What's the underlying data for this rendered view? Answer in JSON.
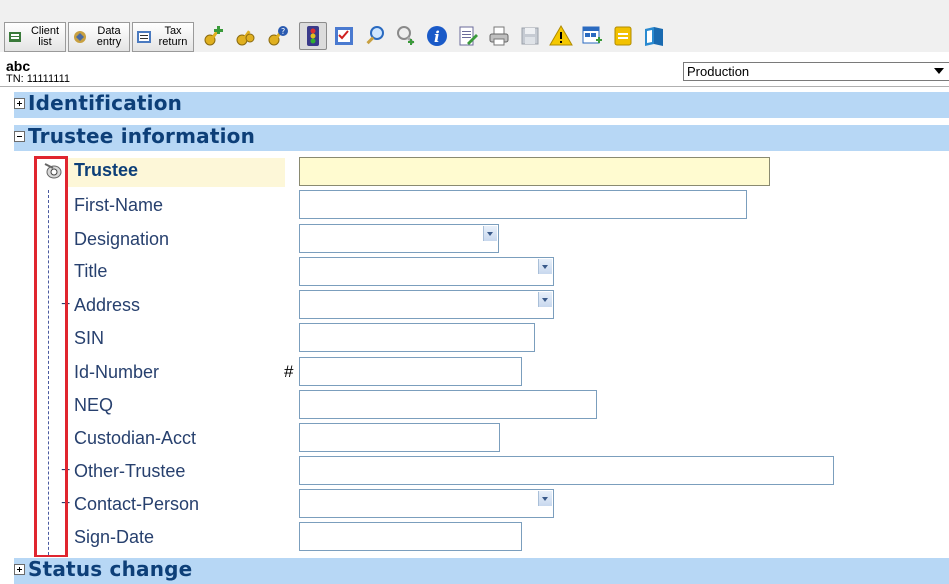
{
  "toolbar": {
    "nav": [
      {
        "label": "Client\nlist"
      },
      {
        "label": "Data\nentry"
      },
      {
        "label": "Tax\nreturn"
      }
    ],
    "icons": [
      "keys-add-icon",
      "keys-icon",
      "keys-help-icon",
      "traffic-light-icon",
      "checklist-icon",
      "search-icon",
      "user-search-icon",
      "info-icon",
      "edit-document-icon",
      "print-icon",
      "save-icon",
      "warning-icon",
      "add-form-icon",
      "note-icon",
      "book-icon"
    ]
  },
  "client": {
    "name": "abc",
    "tn": "TN: 11111111"
  },
  "environment": {
    "selected": "Production"
  },
  "sections": {
    "identification": "Identification",
    "trustee_information": "Trustee information",
    "status_change": "Status change"
  },
  "fields": {
    "trustee": "Trustee",
    "first_name": "First-Name",
    "designation": "Designation",
    "title": "Title",
    "address": "Address",
    "sin": "SIN",
    "id_number": "Id-Number",
    "id_number_prefix": "#",
    "neq": "NEQ",
    "custodian_acct": "Custodian-Acct",
    "other_trustee": "Other-Trustee",
    "contact_person": "Contact-Person",
    "sign_date": "Sign-Date",
    "expand_mark": "+"
  },
  "colors": {
    "section_bg": "#b7d7f5",
    "section_text": "#0d3f78",
    "highlight_box": "#e0252f",
    "trustee_row_bg": "#fdf7d8"
  }
}
